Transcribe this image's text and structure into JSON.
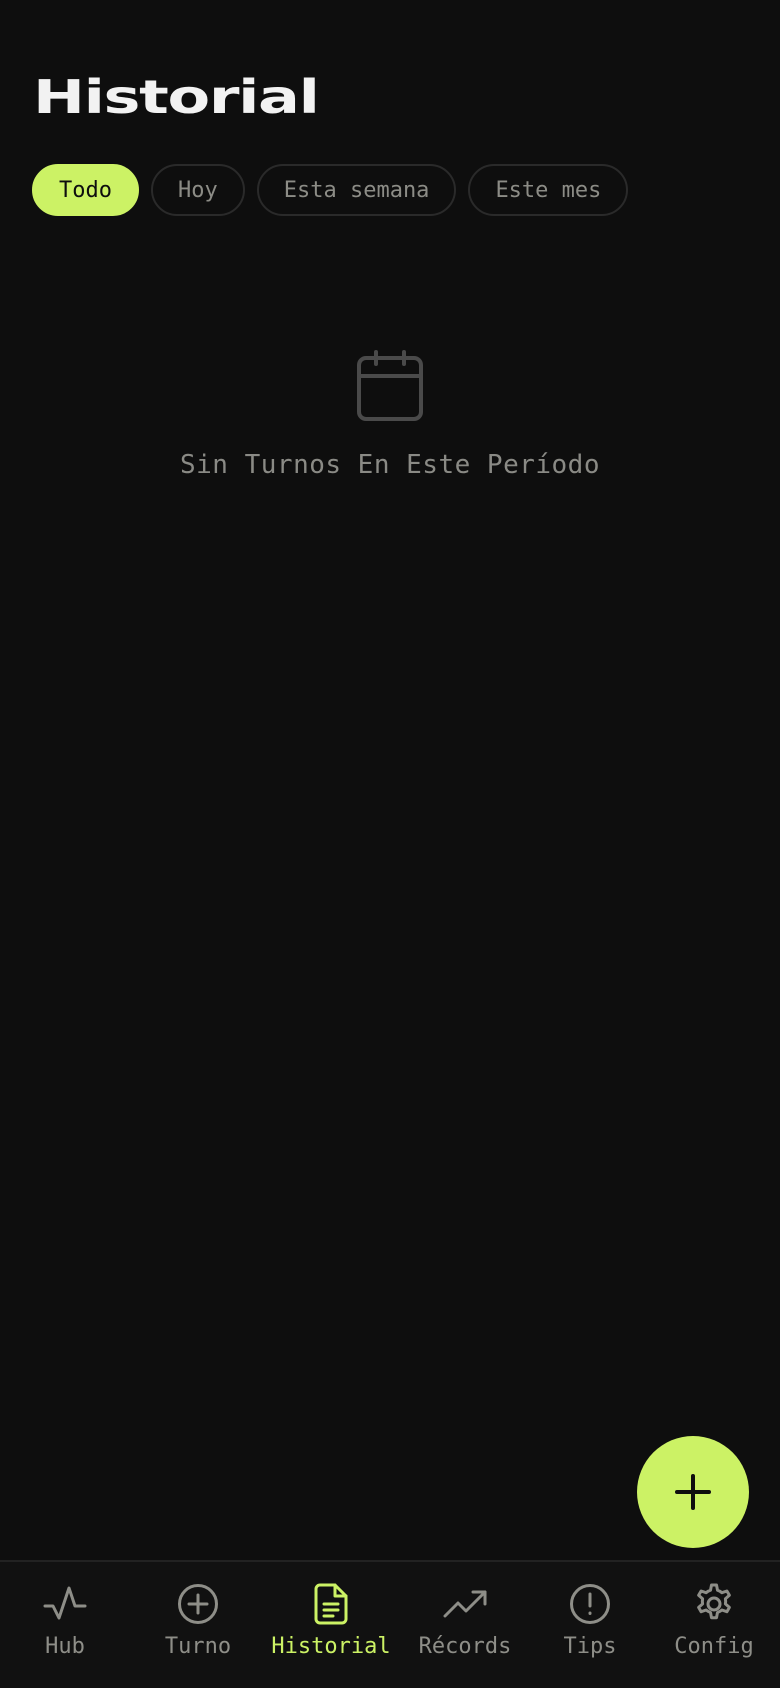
{
  "header": {
    "title": "Historial"
  },
  "filters": {
    "items": [
      {
        "label": "Todo"
      },
      {
        "label": "Hoy"
      },
      {
        "label": "Esta semana"
      },
      {
        "label": "Este mes"
      }
    ],
    "selected": "Todo"
  },
  "empty_state": {
    "icon": "calendar-icon",
    "text": "Sin Turnos En Este Período"
  },
  "fab": {
    "icon": "plus-icon"
  },
  "bottom_nav": {
    "active": "Historial",
    "items": [
      {
        "label": "Hub",
        "icon": "activity-icon"
      },
      {
        "label": "Turno",
        "icon": "plus-circle-icon"
      },
      {
        "label": "Historial",
        "icon": "document-icon"
      },
      {
        "label": "Récords",
        "icon": "trending-up-icon"
      },
      {
        "label": "Tips",
        "icon": "alert-circle-icon"
      },
      {
        "label": "Config",
        "icon": "gear-icon"
      }
    ]
  },
  "colors": {
    "background": "#0e0e0e",
    "accent": "#ccf265",
    "muted_text": "#8c8c86",
    "nav_background": "#111111"
  }
}
